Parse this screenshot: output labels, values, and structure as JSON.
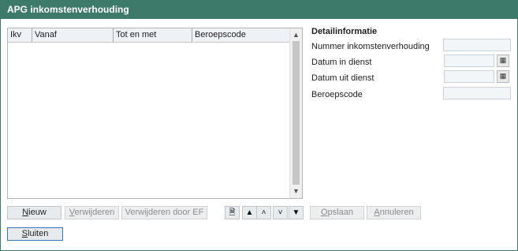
{
  "window": {
    "title": "APG inkomstenverhouding"
  },
  "table": {
    "columns": [
      "Ikv",
      "Vanaf",
      "Tot en met",
      "Beroepscode"
    ],
    "rows": []
  },
  "detail": {
    "heading": "Detailinformatie",
    "fields": {
      "nummer": {
        "label": "Nummer inkomstenverhouding",
        "value": ""
      },
      "datum_in": {
        "label": "Datum in dienst",
        "value": ""
      },
      "datum_uit": {
        "label": "Datum uit dienst",
        "value": ""
      },
      "beroepscode": {
        "label": "Beroepscode",
        "value": ""
      }
    }
  },
  "buttons": {
    "nieuw_u": "N",
    "nieuw_rest": "ieuw",
    "verwijderen_u": "V",
    "verwijderen_rest": "erwijderen",
    "verwijderen_ef": "Verwijderen door EF",
    "opslaan_u": "O",
    "opslaan_rest": "pslaan",
    "annuleren_u": "A",
    "annuleren_rest": "nnuleren",
    "sluiten_u": "S",
    "sluiten_rest": "luiten"
  },
  "icons": {
    "new_page": "new-document-icon",
    "first": "double-up-icon",
    "up": "up-icon",
    "down": "down-icon",
    "last": "double-down-icon",
    "calendar": "calendar-icon"
  },
  "colors": {
    "titlebar": "#3e7a6a",
    "focus_border": "#3b73b9"
  }
}
